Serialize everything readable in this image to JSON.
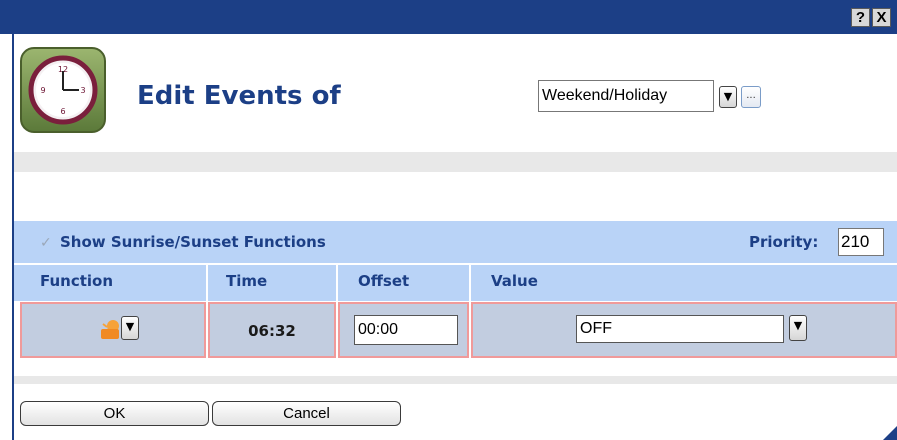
{
  "window": {
    "help_label": "?",
    "close_label": "X"
  },
  "header": {
    "title": "Edit Events of",
    "icon": "wall-clock-icon",
    "schedule_select": {
      "value": "Weekend/Holiday",
      "dropdown_glyph": "▼",
      "more_label": "..."
    }
  },
  "options": {
    "show_sunrise_label": "Show Sunrise/Sunset Functions",
    "show_sunrise_checked": true,
    "check_glyph": "✓",
    "priority_label": "Priority:",
    "priority_value": "210"
  },
  "table": {
    "columns": [
      "Function",
      "Time",
      "Offset",
      "Value"
    ],
    "rows": [
      {
        "function_icon": "sunrise-icon",
        "time": "06:32",
        "offset": "00:00",
        "value": "OFF"
      }
    ],
    "dropdown_glyph": "▼"
  },
  "buttons": {
    "ok": "OK",
    "cancel": "Cancel"
  },
  "colors": {
    "title_bar": "#1c3f86",
    "heading_text": "#1c3f86",
    "row_band": "#b9d3f7",
    "selected_row": "#c2cde0",
    "row_border": "#f09a9a"
  }
}
